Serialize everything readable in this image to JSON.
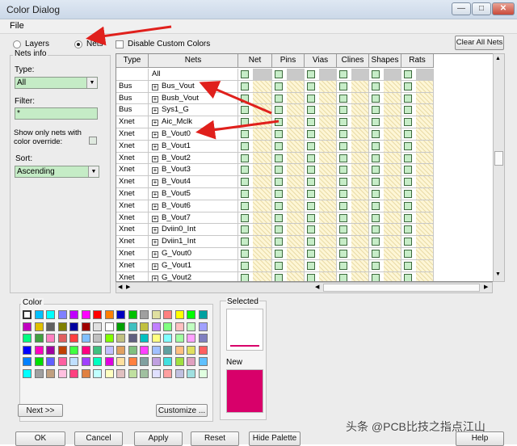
{
  "window": {
    "title": "Color Dialog",
    "minimize": "—",
    "maximize": "□",
    "close": "✕"
  },
  "menu": {
    "file": "File"
  },
  "filter": {
    "layers_label": "Layers",
    "nets_label": "Nets",
    "selected": "Nets",
    "disable_custom_label": "Disable Custom Colors",
    "disable_custom_checked": false,
    "clear_all_label": "Clear All Nets"
  },
  "nets_info": {
    "group_label": "Nets info",
    "type_label": "Type:",
    "type_value": "All",
    "filter_label": "Filter:",
    "filter_value": "*",
    "show_only_label_1": "Show only nets with",
    "show_only_label_2": "color override:",
    "sort_label": "Sort:",
    "sort_value": "Ascending"
  },
  "grid": {
    "columns": [
      "Type",
      "Nets",
      "Net",
      "Pins",
      "Vias",
      "Clines",
      "Shapes",
      "Rats"
    ],
    "all_row": "All",
    "rows": [
      {
        "type": "Bus",
        "net": "Bus_Vout"
      },
      {
        "type": "Bus",
        "net": "Busb_Vout"
      },
      {
        "type": "Bus",
        "net": "Sys1_G"
      },
      {
        "type": "Xnet",
        "net": "Aic_Mclk"
      },
      {
        "type": "Xnet",
        "net": "B_Vout0"
      },
      {
        "type": "Xnet",
        "net": "B_Vout1"
      },
      {
        "type": "Xnet",
        "net": "B_Vout2"
      },
      {
        "type": "Xnet",
        "net": "B_Vout3"
      },
      {
        "type": "Xnet",
        "net": "B_Vout4"
      },
      {
        "type": "Xnet",
        "net": "B_Vout5"
      },
      {
        "type": "Xnet",
        "net": "B_Vout6"
      },
      {
        "type": "Xnet",
        "net": "B_Vout7"
      },
      {
        "type": "Xnet",
        "net": "Dviin0_Int"
      },
      {
        "type": "Xnet",
        "net": "Dviin1_Int"
      },
      {
        "type": "Xnet",
        "net": "G_Vout0"
      },
      {
        "type": "Xnet",
        "net": "G_Vout1"
      },
      {
        "type": "Xnet",
        "net": "G_Vout2"
      }
    ]
  },
  "palette": {
    "group_label": "Color",
    "next_label": "Next >>",
    "customize_label": "Customize ...",
    "colors": [
      [
        "#ffffff",
        "#00c0ff",
        "#00ffff",
        "#8080ff",
        "#c000ff",
        "#ff00ff",
        "#ff0000",
        "#ff8000",
        "#0000c0",
        "#00c000",
        "#a0a0a0",
        "#e0e0a0",
        "#ff8080",
        "#ffff00",
        "#00ff00",
        "#00a0a0"
      ],
      [
        "#c000c0",
        "#e0c000",
        "#606060",
        "#808000",
        "#0000a0",
        "#a00000",
        "#e0e0e0",
        "#ffffff",
        "#00a000",
        "#40c0c0",
        "#c0c040",
        "#c080ff",
        "#80ff80",
        "#ffc0c0",
        "#c0ffc0",
        "#a0a0ff"
      ],
      [
        "#00ff80",
        "#40a040",
        "#ff80c0",
        "#e06060",
        "#ff4040",
        "#80c0ff",
        "#c0c0c0",
        "#80ff00",
        "#c0c080",
        "#606080",
        "#00c0c0",
        "#ffff80",
        "#80ffff",
        "#a0ffa0",
        "#ffa0ff",
        "#8080c0"
      ],
      [
        "#0000ff",
        "#ff00c0",
        "#a000a0",
        "#c04000",
        "#40ff40",
        "#ff0080",
        "#40c080",
        "#c0c0ff",
        "#e0a060",
        "#80c080",
        "#ff40ff",
        "#a0c0ff",
        "#60a0a0",
        "#ffc080",
        "#e0e060",
        "#ff6060"
      ],
      [
        "#0080ff",
        "#00e000",
        "#6060ff",
        "#ff60a0",
        "#c0e0ff",
        "#a040ff",
        "#00ffc0",
        "#e000e0",
        "#ffe0a0",
        "#ff8040",
        "#80a0a0",
        "#c0a0e0",
        "#40e0e0",
        "#a0e040",
        "#e0a0c0",
        "#60c0ff"
      ],
      [
        "#00ffff",
        "#a0a0a0",
        "#c0a080",
        "#ffc0e0",
        "#ff4080",
        "#e08040",
        "#c0ffff",
        "#ffffc0",
        "#e0c0c0",
        "#c0e0a0",
        "#a0c0a0",
        "#e0e0ff",
        "#ffa0a0",
        "#c0c0e0",
        "#a0e0e0",
        "#e0ffe0"
      ]
    ]
  },
  "selected": {
    "label": "Selected",
    "color": "#ffffff",
    "line_color": "#d8006a"
  },
  "new": {
    "label": "New",
    "color": "#d8006a"
  },
  "buttons": {
    "ok": "OK",
    "cancel": "Cancel",
    "apply": "Apply",
    "reset": "Reset",
    "hide_palette": "Hide Palette",
    "help": "Help"
  },
  "watermark": "头条 @PCB比技之指点江山",
  "accent_colors": {
    "arrow": "#e0201c",
    "hatch": "#fdf6d6",
    "check_fill": "#c7edc8"
  }
}
